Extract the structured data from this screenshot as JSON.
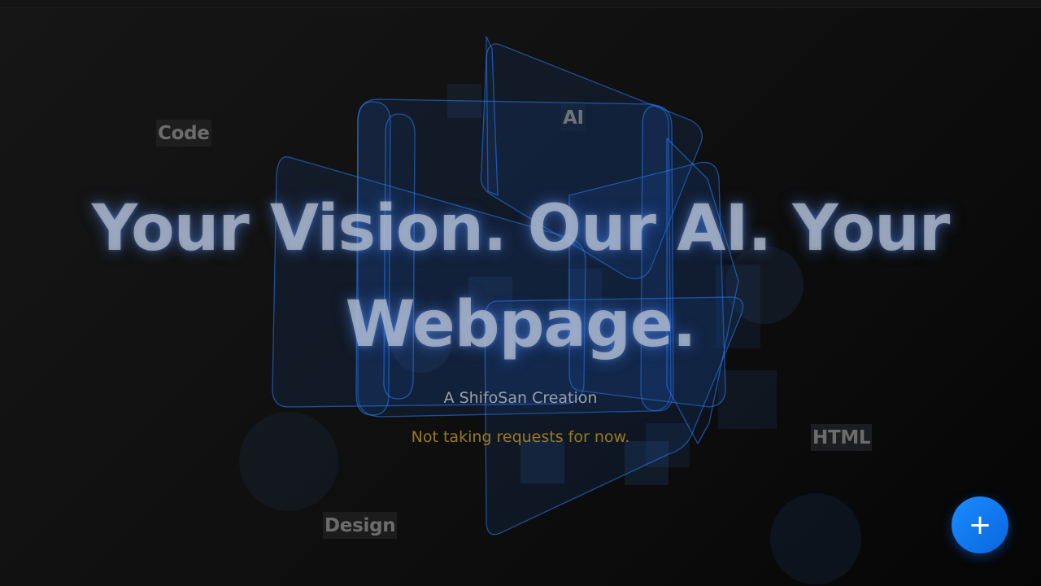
{
  "hero": {
    "title": "Your Vision. Our AI. Your Webpage.",
    "subtitle": "A ShifoSan Creation",
    "notice": "Not taking requests for now."
  },
  "floating_tags": {
    "code": "Code",
    "ai": "AI",
    "html": "HTML",
    "design": "Design"
  },
  "fab": {
    "label": "+",
    "icon": "plus-icon"
  },
  "colors": {
    "background": "#101010",
    "accent": "#1a7ff0",
    "notice": "#9a7a1e",
    "title": "#bec4cd"
  }
}
